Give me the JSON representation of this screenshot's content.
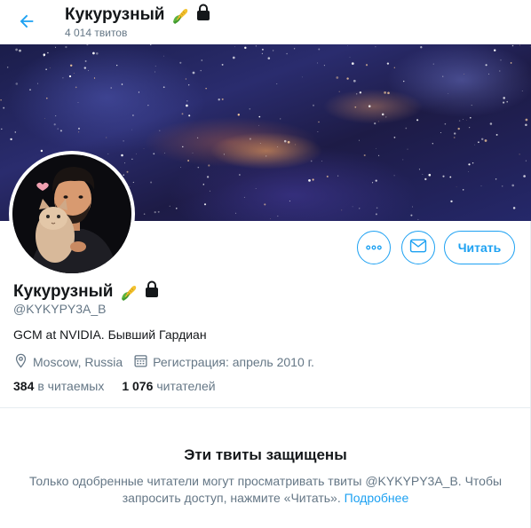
{
  "header": {
    "back_icon": "arrow-left-icon",
    "name": "Кукурузный",
    "tweets_count": "4 014 твитов",
    "badges": [
      "corn-emoji",
      "lock-icon"
    ]
  },
  "profile": {
    "name": "Кукурузный",
    "handle": "@KYKYPY3A_B",
    "bio": "GCM at NVIDIA. Бывший Гардиан",
    "location": "Moscow, Russia",
    "joined": "Регистрация: апрель 2010 г.",
    "following_count": "384",
    "following_label": "в читаемых",
    "followers_count": "1 076",
    "followers_label": "читателей"
  },
  "actions": {
    "more_icon": "more-horizontal-icon",
    "message_icon": "mail-icon",
    "follow_label": "Читать"
  },
  "protected": {
    "title": "Эти твиты защищены",
    "text": "Только одобренные читатели могут просматривать твиты @KYKYPY3A_B. Чтобы запросить доступ, нажмите «Читать».",
    "link": "Подробнее"
  },
  "colors": {
    "accent": "#1da1f2",
    "secondary_text": "#657786",
    "primary_text": "#14171a"
  }
}
